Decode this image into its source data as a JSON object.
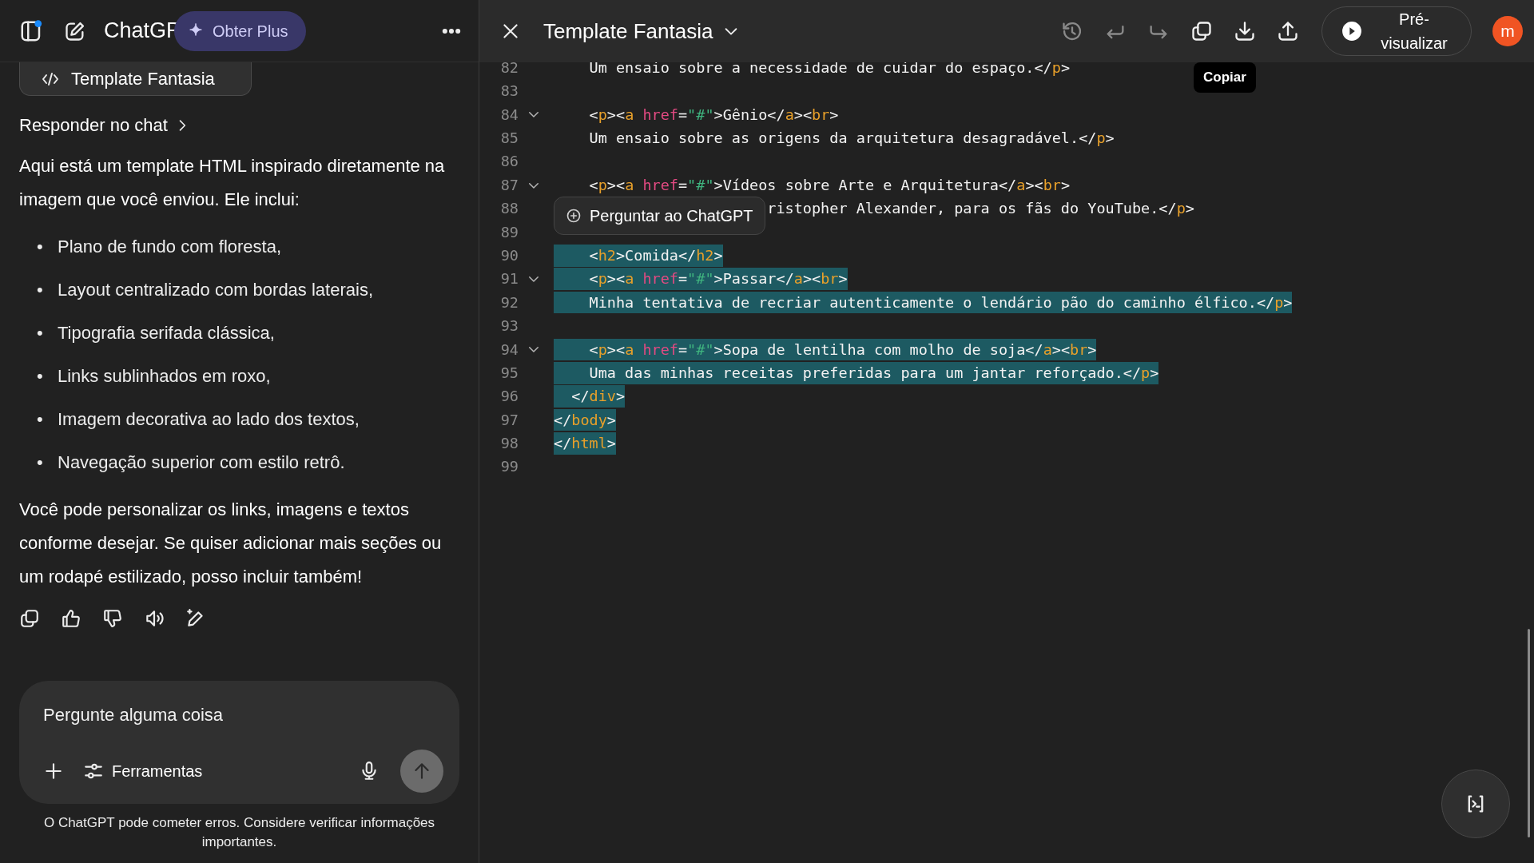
{
  "chat_panel": {
    "header": {
      "title": "ChatGP",
      "upgrade_button": "Obter Plus"
    },
    "artifact_card": {
      "label": "Template Fantasia"
    },
    "reply_link": "Responder no chat",
    "message": {
      "intro": "Aqui está um template HTML inspirado diretamente na imagem que você enviou. Ele inclui:",
      "bullets": [
        {
          "marker": "•",
          "text": "Plano de fundo com floresta,"
        },
        {
          "marker": "•",
          "text": "Layout centralizado com bordas laterais,"
        },
        {
          "marker": "•",
          "text": "Tipografia serifada clássica,"
        },
        {
          "marker": "•",
          "text": "Links sublinhados em roxo,"
        },
        {
          "marker": "•",
          "text": "Imagem decorativa ao lado dos textos,"
        },
        {
          "marker": "•",
          "text": "Navegação superior com estilo retrô."
        }
      ],
      "outro": "Você pode personalizar os links, imagens e textos conforme desejar. Se quiser adicionar mais seções ou um rodapé estilizado, posso incluir também!"
    },
    "actions": [
      {
        "kind": "copy"
      },
      {
        "kind": "like"
      },
      {
        "kind": "dislike"
      },
      {
        "kind": "speak"
      },
      {
        "kind": "edit"
      }
    ],
    "composer": {
      "placeholder": "Pergunte alguma coisa",
      "tools_button": "Ferramentas"
    },
    "disclaimer": "O ChatGPT pode cometer erros. Considere verificar informações importantes."
  },
  "editor": {
    "title": "Template Fantasia",
    "toolbar": [
      {
        "kind": "history",
        "disabled": true
      },
      {
        "kind": "undo",
        "disabled": true
      },
      {
        "kind": "redo",
        "disabled": true
      },
      {
        "kind": "copy",
        "disabled": false
      },
      {
        "kind": "download",
        "disabled": false
      },
      {
        "kind": "share",
        "disabled": false
      }
    ],
    "preview_button": "Pré-visualizar",
    "avatar": "m",
    "tooltip": "Copiar",
    "context_popup": "Perguntar ao ChatGPT",
    "lines": [
      {
        "number": "82",
        "fold": false,
        "selected": false,
        "tokens": [
          {
            "kind": "text",
            "text": "    Um ensaio sobre a necessidade de cuidar do espaço.</"
          },
          {
            "kind": "tag",
            "text": "p"
          },
          {
            "kind": "text",
            "text": ">"
          }
        ]
      },
      {
        "number": "83",
        "fold": false,
        "selected": false
      },
      {
        "number": "84",
        "fold": true,
        "selected": false,
        "tokens": [
          {
            "kind": "text",
            "text": "    <"
          },
          {
            "kind": "tag",
            "text": "p"
          },
          {
            "kind": "text",
            "text": "><"
          },
          {
            "kind": "tag",
            "text": "a"
          },
          {
            "kind": "attr",
            "text": " href"
          },
          {
            "kind": "text",
            "text": "="
          },
          {
            "kind": "string",
            "text": "\"#\""
          },
          {
            "kind": "text",
            "text": ">Gênio</"
          },
          {
            "kind": "tag",
            "text": "a"
          },
          {
            "kind": "text",
            "text": "><"
          },
          {
            "kind": "tag",
            "text": "br"
          },
          {
            "kind": "text",
            "text": ">"
          }
        ]
      },
      {
        "number": "85",
        "fold": false,
        "selected": false,
        "tokens": [
          {
            "kind": "text",
            "text": "    Um ensaio sobre as origens da arquitetura desagradável.</"
          },
          {
            "kind": "tag",
            "text": "p"
          },
          {
            "kind": "text",
            "text": ">"
          }
        ]
      },
      {
        "number": "86",
        "fold": false,
        "selected": false
      },
      {
        "number": "87",
        "fold": true,
        "selected": false,
        "tokens": [
          {
            "kind": "text",
            "text": "    <"
          },
          {
            "kind": "tag",
            "text": "p"
          },
          {
            "kind": "text",
            "text": "><"
          },
          {
            "kind": "tag",
            "text": "a"
          },
          {
            "kind": "attr",
            "text": " href"
          },
          {
            "kind": "text",
            "text": "="
          },
          {
            "kind": "string",
            "text": "\"#\""
          },
          {
            "kind": "text",
            "text": ">Vídeos sobre Arte e Arquitetura</"
          },
          {
            "kind": "tag",
            "text": "a"
          },
          {
            "kind": "text",
            "text": "><"
          },
          {
            "kind": "tag",
            "text": "br"
          },
          {
            "kind": "text",
            "text": ">"
          }
        ]
      },
      {
        "number": "88",
        "fold": false,
        "selected": false,
        "start_covered": true,
        "tokens": [
          {
            "kind": "text",
            "text": "ristopher Alexander, para os fãs do YouTube.</"
          },
          {
            "kind": "tag",
            "text": "p"
          },
          {
            "kind": "text",
            "text": ">"
          }
        ]
      },
      {
        "number": "89",
        "fold": false,
        "selected": false
      },
      {
        "number": "90",
        "fold": false,
        "selected": true,
        "tokens": [
          {
            "kind": "text",
            "text": "    <"
          },
          {
            "kind": "tag",
            "text": "h2"
          },
          {
            "kind": "text",
            "text": ">Comida</"
          },
          {
            "kind": "tag",
            "text": "h2"
          },
          {
            "kind": "text",
            "text": ">"
          }
        ]
      },
      {
        "number": "91",
        "fold": true,
        "selected": true,
        "tokens": [
          {
            "kind": "text",
            "text": "    <"
          },
          {
            "kind": "tag",
            "text": "p"
          },
          {
            "kind": "text",
            "text": "><"
          },
          {
            "kind": "tag",
            "text": "a"
          },
          {
            "kind": "attr",
            "text": " href"
          },
          {
            "kind": "text",
            "text": "="
          },
          {
            "kind": "string",
            "text": "\"#\""
          },
          {
            "kind": "text",
            "text": ">Passar</"
          },
          {
            "kind": "tag",
            "text": "a"
          },
          {
            "kind": "text",
            "text": "><"
          },
          {
            "kind": "tag",
            "text": "br"
          },
          {
            "kind": "text",
            "text": ">"
          }
        ]
      },
      {
        "number": "92",
        "fold": false,
        "selected": true,
        "tokens": [
          {
            "kind": "text",
            "text": "    Minha tentativa de recriar autenticamente o lendário pão do caminho élfico.</"
          },
          {
            "kind": "tag",
            "text": "p"
          },
          {
            "kind": "text",
            "text": ">"
          }
        ]
      },
      {
        "number": "93",
        "fold": false,
        "selected": false
      },
      {
        "number": "94",
        "fold": true,
        "selected": true,
        "tokens": [
          {
            "kind": "text",
            "text": "    <"
          },
          {
            "kind": "tag",
            "text": "p"
          },
          {
            "kind": "text",
            "text": "><"
          },
          {
            "kind": "tag",
            "text": "a"
          },
          {
            "kind": "attr",
            "text": " href"
          },
          {
            "kind": "text",
            "text": "="
          },
          {
            "kind": "string",
            "text": "\"#\""
          },
          {
            "kind": "text",
            "text": ">Sopa de lentilha com molho de soja</"
          },
          {
            "kind": "tag",
            "text": "a"
          },
          {
            "kind": "text",
            "text": "><"
          },
          {
            "kind": "tag",
            "text": "br"
          },
          {
            "kind": "text",
            "text": ">"
          }
        ]
      },
      {
        "number": "95",
        "fold": false,
        "selected": true,
        "tokens": [
          {
            "kind": "text",
            "text": "    Uma das minhas receitas preferidas para um jantar reforçado.</"
          },
          {
            "kind": "tag",
            "text": "p"
          },
          {
            "kind": "text",
            "text": ">"
          }
        ]
      },
      {
        "number": "96",
        "fold": false,
        "selected": true,
        "tokens": [
          {
            "kind": "text",
            "text": "  </"
          },
          {
            "kind": "tag",
            "text": "div"
          },
          {
            "kind": "text",
            "text": ">"
          }
        ]
      },
      {
        "number": "97",
        "fold": false,
        "selected": true,
        "tokens": [
          {
            "kind": "text",
            "text": "</"
          },
          {
            "kind": "tag",
            "text": "body"
          },
          {
            "kind": "text",
            "text": ">"
          }
        ]
      },
      {
        "number": "98",
        "fold": false,
        "selected": true,
        "tokens": [
          {
            "kind": "text",
            "text": "</"
          },
          {
            "kind": "tag",
            "text": "html"
          },
          {
            "kind": "text",
            "text": ">"
          }
        ]
      },
      {
        "number": "99",
        "fold": false,
        "selected": false
      }
    ]
  }
}
